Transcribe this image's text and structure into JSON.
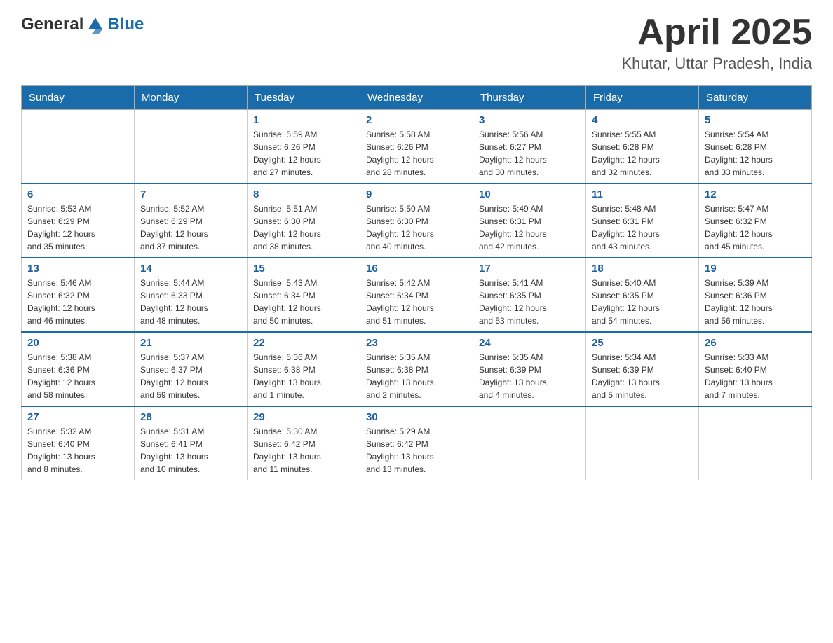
{
  "header": {
    "logo": {
      "general": "General",
      "blue": "Blue"
    },
    "title": "April 2025",
    "location": "Khutar, Uttar Pradesh, India"
  },
  "days_of_week": [
    "Sunday",
    "Monday",
    "Tuesday",
    "Wednesday",
    "Thursday",
    "Friday",
    "Saturday"
  ],
  "weeks": [
    [
      {
        "day": "",
        "info": ""
      },
      {
        "day": "",
        "info": ""
      },
      {
        "day": "1",
        "info": "Sunrise: 5:59 AM\nSunset: 6:26 PM\nDaylight: 12 hours\nand 27 minutes."
      },
      {
        "day": "2",
        "info": "Sunrise: 5:58 AM\nSunset: 6:26 PM\nDaylight: 12 hours\nand 28 minutes."
      },
      {
        "day": "3",
        "info": "Sunrise: 5:56 AM\nSunset: 6:27 PM\nDaylight: 12 hours\nand 30 minutes."
      },
      {
        "day": "4",
        "info": "Sunrise: 5:55 AM\nSunset: 6:28 PM\nDaylight: 12 hours\nand 32 minutes."
      },
      {
        "day": "5",
        "info": "Sunrise: 5:54 AM\nSunset: 6:28 PM\nDaylight: 12 hours\nand 33 minutes."
      }
    ],
    [
      {
        "day": "6",
        "info": "Sunrise: 5:53 AM\nSunset: 6:29 PM\nDaylight: 12 hours\nand 35 minutes."
      },
      {
        "day": "7",
        "info": "Sunrise: 5:52 AM\nSunset: 6:29 PM\nDaylight: 12 hours\nand 37 minutes."
      },
      {
        "day": "8",
        "info": "Sunrise: 5:51 AM\nSunset: 6:30 PM\nDaylight: 12 hours\nand 38 minutes."
      },
      {
        "day": "9",
        "info": "Sunrise: 5:50 AM\nSunset: 6:30 PM\nDaylight: 12 hours\nand 40 minutes."
      },
      {
        "day": "10",
        "info": "Sunrise: 5:49 AM\nSunset: 6:31 PM\nDaylight: 12 hours\nand 42 minutes."
      },
      {
        "day": "11",
        "info": "Sunrise: 5:48 AM\nSunset: 6:31 PM\nDaylight: 12 hours\nand 43 minutes."
      },
      {
        "day": "12",
        "info": "Sunrise: 5:47 AM\nSunset: 6:32 PM\nDaylight: 12 hours\nand 45 minutes."
      }
    ],
    [
      {
        "day": "13",
        "info": "Sunrise: 5:46 AM\nSunset: 6:32 PM\nDaylight: 12 hours\nand 46 minutes."
      },
      {
        "day": "14",
        "info": "Sunrise: 5:44 AM\nSunset: 6:33 PM\nDaylight: 12 hours\nand 48 minutes."
      },
      {
        "day": "15",
        "info": "Sunrise: 5:43 AM\nSunset: 6:34 PM\nDaylight: 12 hours\nand 50 minutes."
      },
      {
        "day": "16",
        "info": "Sunrise: 5:42 AM\nSunset: 6:34 PM\nDaylight: 12 hours\nand 51 minutes."
      },
      {
        "day": "17",
        "info": "Sunrise: 5:41 AM\nSunset: 6:35 PM\nDaylight: 12 hours\nand 53 minutes."
      },
      {
        "day": "18",
        "info": "Sunrise: 5:40 AM\nSunset: 6:35 PM\nDaylight: 12 hours\nand 54 minutes."
      },
      {
        "day": "19",
        "info": "Sunrise: 5:39 AM\nSunset: 6:36 PM\nDaylight: 12 hours\nand 56 minutes."
      }
    ],
    [
      {
        "day": "20",
        "info": "Sunrise: 5:38 AM\nSunset: 6:36 PM\nDaylight: 12 hours\nand 58 minutes."
      },
      {
        "day": "21",
        "info": "Sunrise: 5:37 AM\nSunset: 6:37 PM\nDaylight: 12 hours\nand 59 minutes."
      },
      {
        "day": "22",
        "info": "Sunrise: 5:36 AM\nSunset: 6:38 PM\nDaylight: 13 hours\nand 1 minute."
      },
      {
        "day": "23",
        "info": "Sunrise: 5:35 AM\nSunset: 6:38 PM\nDaylight: 13 hours\nand 2 minutes."
      },
      {
        "day": "24",
        "info": "Sunrise: 5:35 AM\nSunset: 6:39 PM\nDaylight: 13 hours\nand 4 minutes."
      },
      {
        "day": "25",
        "info": "Sunrise: 5:34 AM\nSunset: 6:39 PM\nDaylight: 13 hours\nand 5 minutes."
      },
      {
        "day": "26",
        "info": "Sunrise: 5:33 AM\nSunset: 6:40 PM\nDaylight: 13 hours\nand 7 minutes."
      }
    ],
    [
      {
        "day": "27",
        "info": "Sunrise: 5:32 AM\nSunset: 6:40 PM\nDaylight: 13 hours\nand 8 minutes."
      },
      {
        "day": "28",
        "info": "Sunrise: 5:31 AM\nSunset: 6:41 PM\nDaylight: 13 hours\nand 10 minutes."
      },
      {
        "day": "29",
        "info": "Sunrise: 5:30 AM\nSunset: 6:42 PM\nDaylight: 13 hours\nand 11 minutes."
      },
      {
        "day": "30",
        "info": "Sunrise: 5:29 AM\nSunset: 6:42 PM\nDaylight: 13 hours\nand 13 minutes."
      },
      {
        "day": "",
        "info": ""
      },
      {
        "day": "",
        "info": ""
      },
      {
        "day": "",
        "info": ""
      }
    ]
  ]
}
